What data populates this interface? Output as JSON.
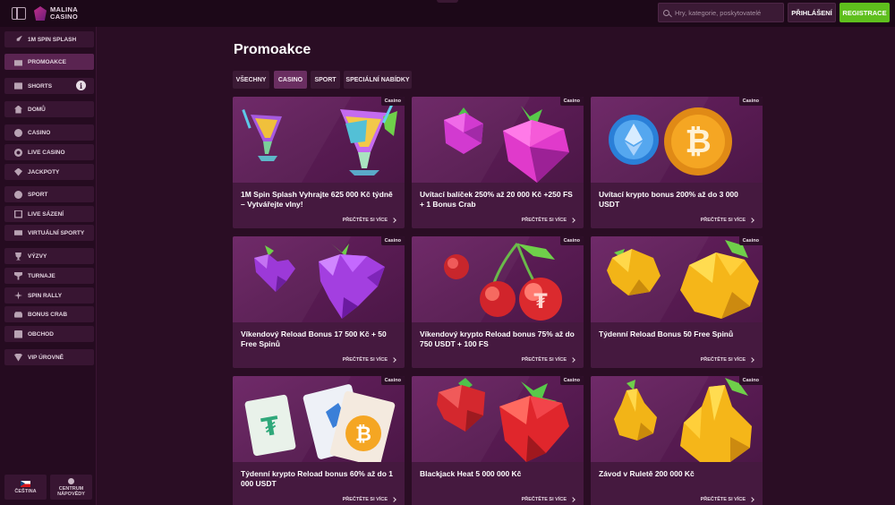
{
  "header": {
    "logo_line1": "MALINA",
    "logo_line2": "CASINO",
    "search_placeholder": "Hry, kategorie, poskytovatelé",
    "login_label": "PŘIHLÁŠENÍ",
    "register_label": "REGISTRACE"
  },
  "sidebar": {
    "items": [
      {
        "label": "1M SPIN SPLASH",
        "icon": "rocket-icon"
      },
      {
        "label": "PROMOAKCE",
        "icon": "gift-icon"
      },
      {
        "label": "SHORTS",
        "icon": "shorts-icon"
      },
      {
        "label": "DOMŮ",
        "icon": "home-icon"
      },
      {
        "label": "CASINO",
        "icon": "casino-icon"
      },
      {
        "label": "LIVE CASINO",
        "icon": "live-casino-icon"
      },
      {
        "label": "JACKPOTY",
        "icon": "jackpot-icon"
      },
      {
        "label": "SPORT",
        "icon": "sport-icon"
      },
      {
        "label": "LIVE SÁZENÍ",
        "icon": "live-betting-icon"
      },
      {
        "label": "VIRTUÁLNÍ SPORTY",
        "icon": "virtual-sports-icon"
      },
      {
        "label": "VÝZVY",
        "icon": "challenges-icon"
      },
      {
        "label": "TURNAJE",
        "icon": "tournaments-icon"
      },
      {
        "label": "SPIN RALLY",
        "icon": "spin-rally-icon"
      },
      {
        "label": "BONUS CRAB",
        "icon": "bonus-crab-icon"
      },
      {
        "label": "OBCHOD",
        "icon": "shop-icon"
      },
      {
        "label": "VIP ÚROVNĚ",
        "icon": "vip-icon"
      }
    ],
    "language_label": "ČEŠTINA",
    "help_label_line1": "CENTRUM",
    "help_label_line2": "NÁPOVĚDY"
  },
  "main": {
    "title": "Promoakce",
    "tabs": [
      {
        "label": "VŠECHNY"
      },
      {
        "label": "CASINO"
      },
      {
        "label": "SPORT"
      },
      {
        "label": "SPECIÁLNÍ NABÍDKY"
      }
    ],
    "read_more": "PŘEČTĚTE SI VÍCE",
    "promos": [
      {
        "badge": "Casino",
        "title": "1M Spin Splash Vyhrajte 625 000 Kč týdně – Vytvářejte vlny!",
        "art": "cocktails"
      },
      {
        "badge": "Casino",
        "title": "Uvítací balíček 250% až 20 000 Kč +250 FS + 1 Bonus Crab",
        "art": "raspberries"
      },
      {
        "badge": "Casino",
        "title": "Uvítací krypto bonus 200% až do 3 000 USDT",
        "art": "crypto-coins"
      },
      {
        "badge": "Casino",
        "title": "Víkendový Reload Bonus 17 500 Kč + 50 Free Spinů",
        "art": "grapes"
      },
      {
        "badge": "Casino",
        "title": "Víkendový krypto Reload bonus 75% až do 750 USDT + 100 FS",
        "art": "cherries"
      },
      {
        "badge": "Casino",
        "title": "Týdenní Reload Bonus 50 Free Spinů",
        "art": "lemons"
      },
      {
        "badge": "Casino",
        "title": "Týdenní krypto Reload bonus 60% až do 1 000 USDT",
        "art": "cards"
      },
      {
        "badge": "Casino",
        "title": "Blackjack Heat 5 000 000 Kč",
        "art": "strawberries"
      },
      {
        "badge": "Casino",
        "title": "Závod v Ruletě 200 000 Kč",
        "art": "pears"
      }
    ]
  }
}
